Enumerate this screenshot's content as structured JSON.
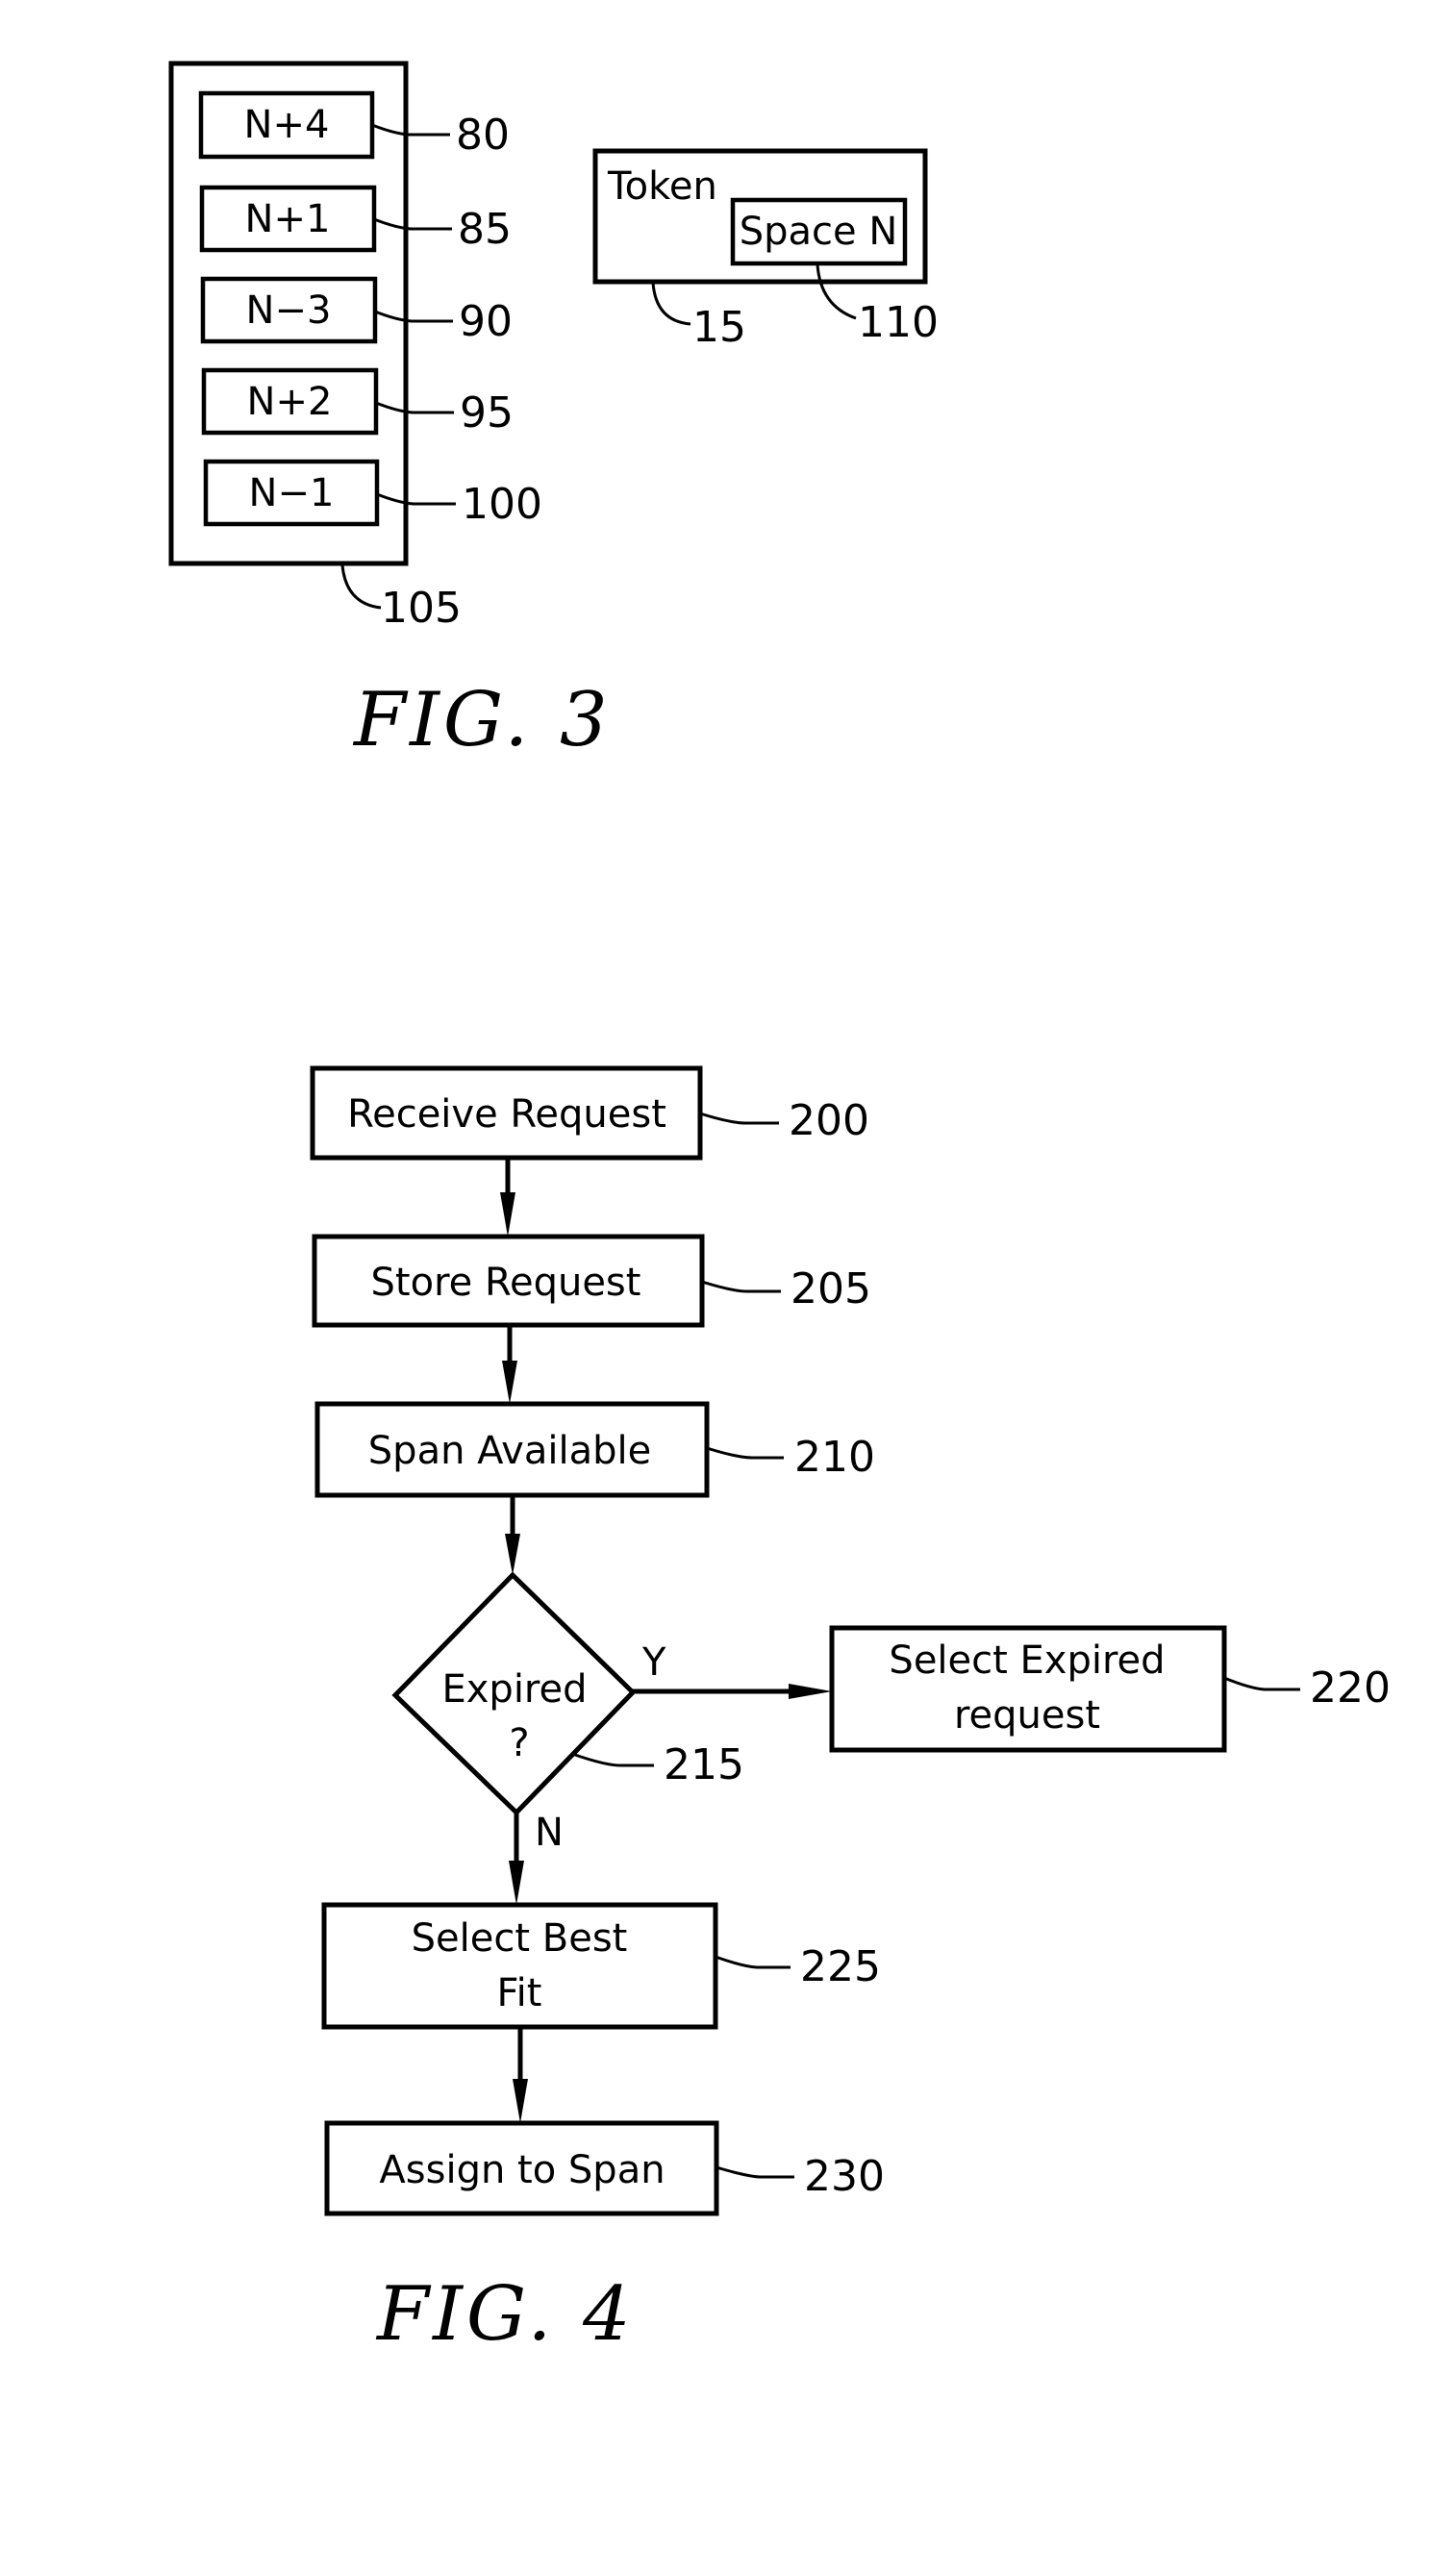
{
  "fig3": {
    "caption": "FIG.  3",
    "stack": {
      "ref": "105",
      "items": [
        {
          "label": "N+4",
          "ref": "80"
        },
        {
          "label": "N+1",
          "ref": "85"
        },
        {
          "label": "N−3",
          "ref": "90"
        },
        {
          "label": "N+2",
          "ref": "95"
        },
        {
          "label": "N−1",
          "ref": "100"
        }
      ]
    },
    "token": {
      "title": "Token",
      "ref": "15",
      "space": {
        "label": "Space N",
        "ref": "110"
      }
    }
  },
  "fig4": {
    "caption": "FIG.  4",
    "steps": {
      "receive": {
        "label": "Receive Request",
        "ref": "200"
      },
      "store": {
        "label": "Store Request",
        "ref": "205"
      },
      "span": {
        "label": "Span Available",
        "ref": "210"
      },
      "decision": {
        "line1": "Expired",
        "line2": "?",
        "ref": "215",
        "yes": "Y",
        "no": "N"
      },
      "expired": {
        "line1": "Select Expired",
        "line2": "request",
        "ref": "220"
      },
      "bestfit": {
        "line1": "Select Best",
        "line2": "Fit",
        "ref": "225"
      },
      "assign": {
        "label": "Assign to Span",
        "ref": "230"
      }
    }
  }
}
